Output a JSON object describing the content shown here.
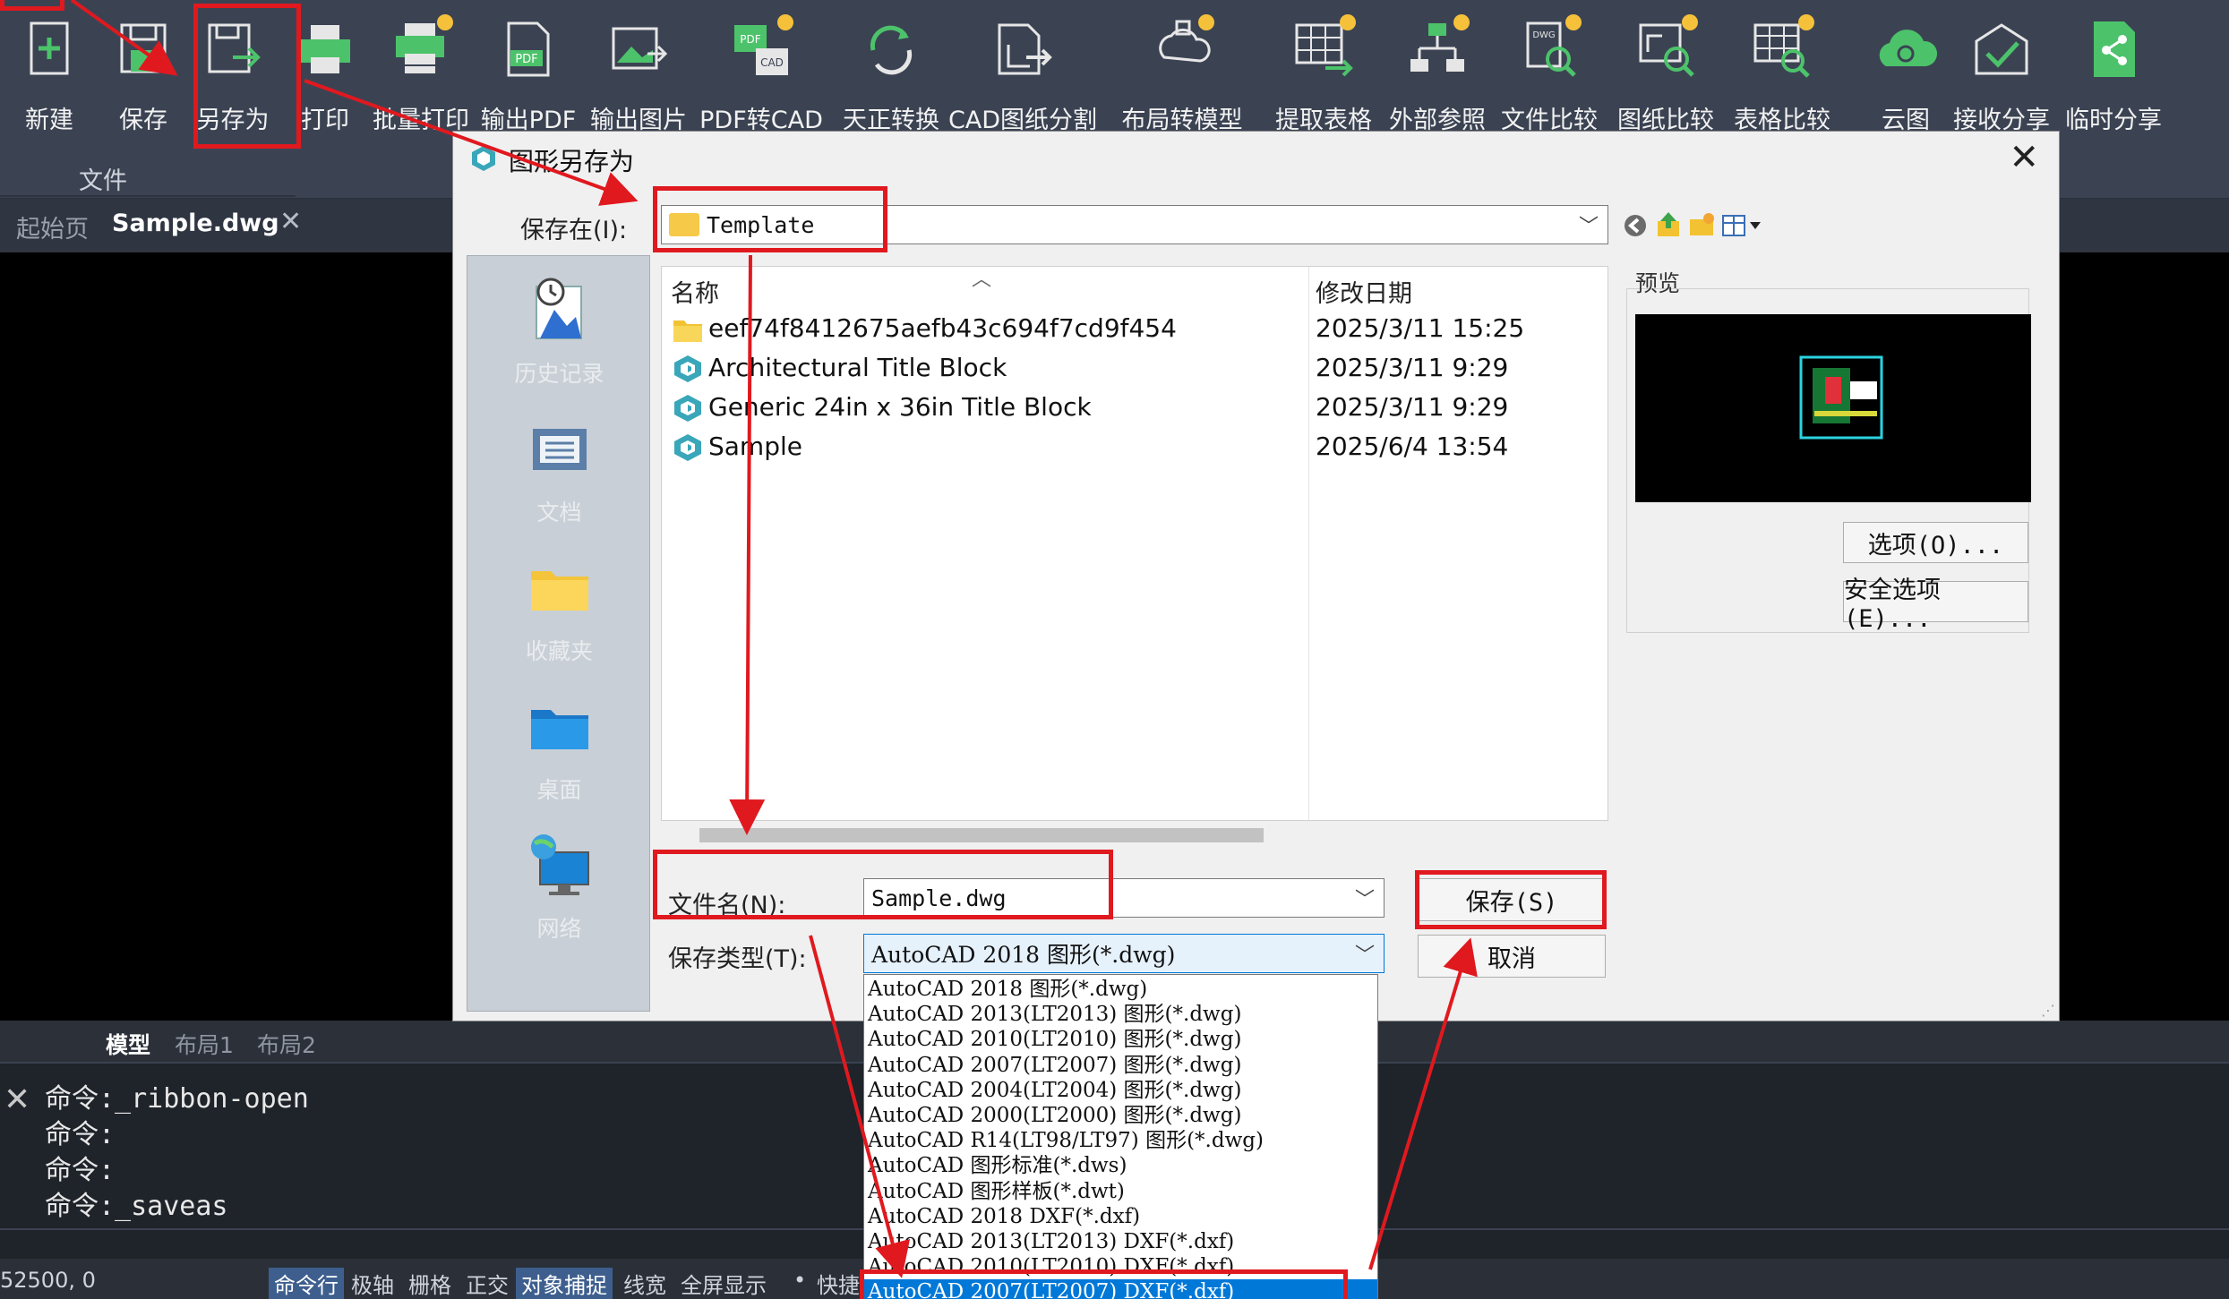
{
  "ribbon": {
    "tools": [
      {
        "id": "new",
        "label": "新建",
        "icon": "new-file-icon"
      },
      {
        "id": "save",
        "label": "保存",
        "icon": "save-icon"
      },
      {
        "id": "saveas",
        "label": "另存为",
        "icon": "save-as-icon"
      },
      {
        "id": "print",
        "label": "打印",
        "icon": "print-icon"
      },
      {
        "id": "batchprint",
        "label": "批量打印",
        "icon": "batch-print-icon"
      },
      {
        "id": "exportpdf",
        "label": "输出PDF",
        "icon": "pdf-icon"
      },
      {
        "id": "exportimg",
        "label": "输出图片",
        "icon": "image-icon"
      },
      {
        "id": "pdf2cad",
        "label": "PDF转CAD",
        "icon": "pdf-to-cad-icon"
      },
      {
        "id": "tzconvert",
        "label": "天正转换",
        "icon": "convert-icon"
      },
      {
        "id": "split",
        "label": "CAD图纸分割",
        "icon": "split-icon"
      },
      {
        "id": "layout2model",
        "label": "布局转模型",
        "icon": "layout-to-model-icon"
      },
      {
        "id": "extracttable",
        "label": "提取表格",
        "icon": "table-extract-icon"
      },
      {
        "id": "xref",
        "label": "外部参照",
        "icon": "xref-icon"
      },
      {
        "id": "filecompare",
        "label": "文件比较",
        "icon": "file-compare-icon"
      },
      {
        "id": "drawcompare",
        "label": "图纸比较",
        "icon": "drawing-compare-icon"
      },
      {
        "id": "tablecompare",
        "label": "表格比较",
        "icon": "table-compare-icon"
      },
      {
        "id": "cloud",
        "label": "云图",
        "icon": "cloud-icon"
      },
      {
        "id": "receive",
        "label": "接收分享",
        "icon": "receive-share-icon"
      },
      {
        "id": "tempshare",
        "label": "临时分享",
        "icon": "share-icon"
      }
    ],
    "group_label": "文件"
  },
  "tabs": {
    "home": "起始页",
    "file": "Sample.dwg",
    "close": "✕"
  },
  "dialog": {
    "title": "图形另存为",
    "close": "✕",
    "save_in_label": "保存在(I):",
    "save_in_value": "Template",
    "places": [
      "历史记录",
      "文档",
      "收藏夹",
      "桌面",
      "网络"
    ],
    "columns": {
      "name": "名称",
      "date": "修改日期"
    },
    "files": [
      {
        "name": "eef74f8412675aefb43c694f7cd9f454",
        "date": "2025/3/11 15:25",
        "type": "folder"
      },
      {
        "name": "Architectural Title Block",
        "date": "2025/3/11 9:29",
        "type": "dwg"
      },
      {
        "name": "Generic 24in x 36in Title Block",
        "date": "2025/3/11 9:29",
        "type": "dwg"
      },
      {
        "name": "Sample",
        "date": "2025/6/4 13:54",
        "type": "dwg"
      }
    ],
    "preview_label": "预览",
    "options_button": "选项(O)...",
    "security_button": "安全选项(E)...",
    "filename_label": "文件名(N):",
    "filename_value": "Sample.dwg",
    "filetype_label": "保存类型(T):",
    "filetype_value": "AutoCAD 2018 图形(*.dwg)",
    "save_button": "保存(S)",
    "cancel_button": "取消",
    "filetype_options": [
      "AutoCAD 2018 图形(*.dwg)",
      "AutoCAD 2013(LT2013) 图形(*.dwg)",
      "AutoCAD 2010(LT2010) 图形(*.dwg)",
      "AutoCAD 2007(LT2007) 图形(*.dwg)",
      "AutoCAD 2004(LT2004) 图形(*.dwg)",
      "AutoCAD 2000(LT2000) 图形(*.dwg)",
      "AutoCAD R14(LT98/LT97) 图形(*.dwg)",
      "AutoCAD 图形标准(*.dws)",
      "AutoCAD 图形样板(*.dwt)",
      "AutoCAD 2018 DXF(*.dxf)",
      "AutoCAD 2013(LT2013) DXF(*.dxf)",
      "AutoCAD 2010(LT2010) DXF(*.dxf)",
      "AutoCAD 2007(LT2007) DXF(*.dxf)"
    ],
    "selected_option_index": 12
  },
  "layout_tabs": [
    "模型",
    "布局1",
    "布局2"
  ],
  "command_lines": [
    "命令:_ribbon-open",
    "命令:",
    "命令:",
    "命令:_saveas"
  ],
  "status": {
    "coords": "52500, 0",
    "items": [
      "命令行",
      "极轴",
      "栅格",
      "正交",
      "对象捕捉",
      "线宽",
      "全屏显示",
      "•",
      "快捷"
    ]
  },
  "colors": {
    "ribbon_bg": "#3b4353",
    "accent_red": "#e0191f",
    "selection_blue": "#0078d7",
    "icon_green": "#4cc36a"
  }
}
